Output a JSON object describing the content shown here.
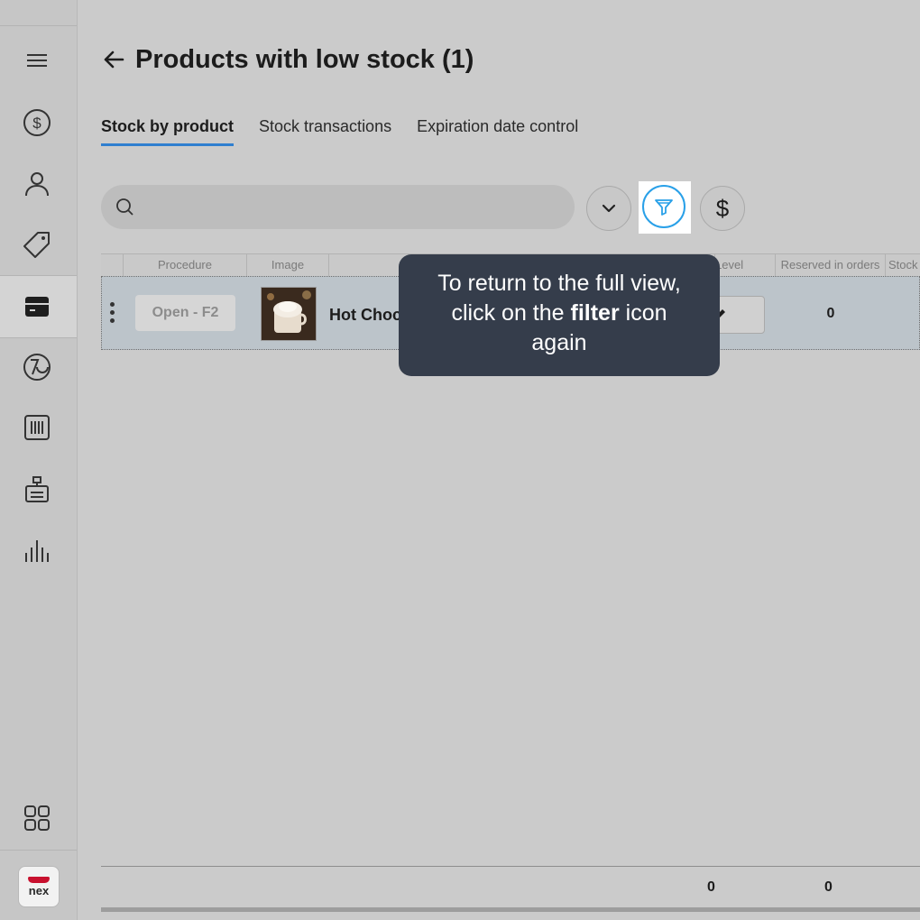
{
  "page": {
    "title": "Products with low stock (1)"
  },
  "tabs": [
    {
      "label": "Stock by product",
      "active": true
    },
    {
      "label": "Stock transactions",
      "active": false
    },
    {
      "label": "Expiration date control",
      "active": false
    }
  ],
  "search": {
    "placeholder": "",
    "value": ""
  },
  "toolbar": {
    "dropdown_icon": "chevron-down-icon",
    "filter_icon": "filter-icon",
    "currency_label": "$"
  },
  "table": {
    "columns": [
      "Procedure",
      "Image",
      "Level",
      "Reserved in orders",
      "Stock"
    ],
    "rows": [
      {
        "procedure": "Open - F2",
        "image": "hot-chocolate-photo",
        "name": "Hot Choc",
        "reserved": "0"
      }
    ],
    "totals": [
      "0",
      "0"
    ]
  },
  "tooltip": {
    "line1": "To return to the full view,",
    "line2_pre": "click on the ",
    "line2_bold": "filter",
    "line2_post": " icon",
    "line3": "again"
  },
  "sidebar": {
    "items": [
      "menu-icon",
      "dollar-icon",
      "person-icon",
      "tag-icon",
      "box-icon",
      "chart-pie-icon",
      "barcode-icon",
      "register-icon",
      "bar-chart-icon",
      "apps-icon"
    ],
    "logo_text": "nex"
  },
  "colors": {
    "accent": "#2f7fd0",
    "tooltip_bg": "#353d4b",
    "filter_ring": "#29a0e8",
    "brand_red": "#c8102e"
  }
}
